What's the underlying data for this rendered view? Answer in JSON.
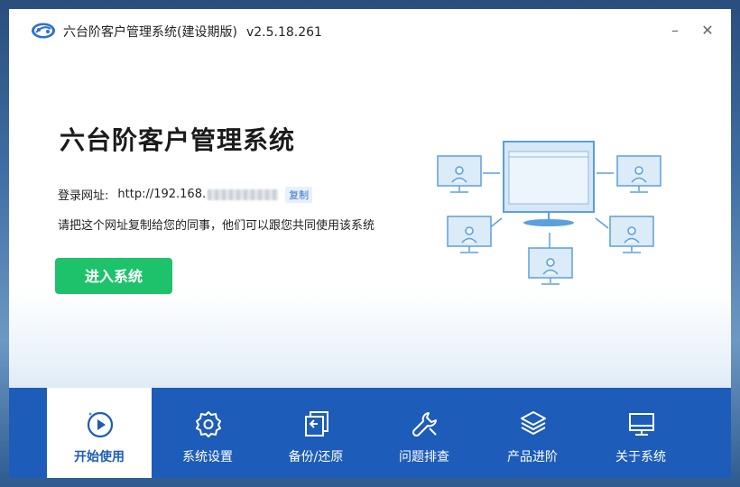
{
  "window": {
    "title": "六台阶客户管理系统(建设期版)",
    "version": "v2.5.18.261",
    "minimize_glyph": "–",
    "close_glyph": "✕"
  },
  "main": {
    "heading": "六台阶客户管理系统",
    "url_label": "登录网址:",
    "url_value": "http://192.168.",
    "copy_label": "复制",
    "share_hint": "请把这个网址复制给您的同事，他们可以跟您共同使用该系统",
    "enter_button": "进入系统"
  },
  "nav": {
    "items": [
      {
        "label": "开始使用",
        "icon": "play-icon",
        "active": true
      },
      {
        "label": "系统设置",
        "icon": "gear-icon",
        "active": false
      },
      {
        "label": "备份/还原",
        "icon": "backup-restore-icon",
        "active": false
      },
      {
        "label": "问题排查",
        "icon": "wrench-icon",
        "active": false
      },
      {
        "label": "产品进阶",
        "icon": "layers-icon",
        "active": false
      },
      {
        "label": "关于系统",
        "icon": "monitor-icon",
        "active": false
      }
    ]
  },
  "colors": {
    "nav_bg": "#1d5cb8",
    "enter_button_bg": "#1ec26a",
    "illustration_stroke": "#5aa0df"
  }
}
